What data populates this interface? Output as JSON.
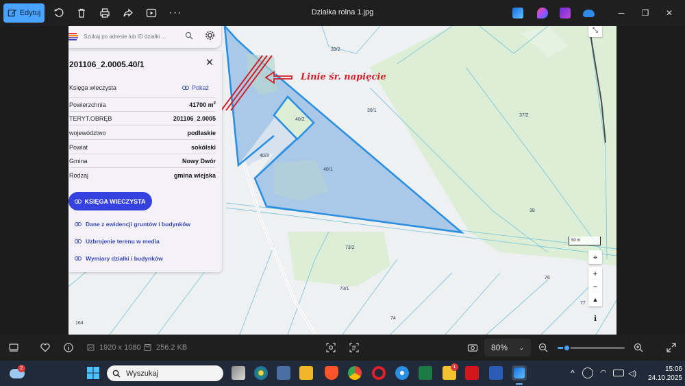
{
  "titlebar": {
    "edit_label": "Edytuj",
    "title": "Działka rolna 1.jpg"
  },
  "search": {
    "placeholder": "Szukaj po adresie lub ID działki ..."
  },
  "panel": {
    "title": "201106_2.0005.40/1",
    "rows": [
      {
        "key": "Księga wieczysta",
        "link": "Pokaż"
      },
      {
        "key": "Powierzchnia",
        "value": "41700 m",
        "sup": "2"
      },
      {
        "key": "TERYT.OBRĘB",
        "value": "201106_2.0005"
      },
      {
        "key": "województwo",
        "value": "podlaskie"
      },
      {
        "key": "Powiat",
        "value": "sokólski"
      },
      {
        "key": "Gmina",
        "value": "Nowy Dwór"
      },
      {
        "key": "Rodzaj",
        "value": "gmina wiejska"
      }
    ],
    "primary_button": "KSIĘGA WIECZYSTA",
    "links": [
      "Dane z ewidencji gruntów i budynków",
      "Uzbrojenie terenu w media",
      "Wymiary działki i budynków"
    ]
  },
  "map": {
    "annotation": "Linie śr. napięcie",
    "parcels": [
      "39/2",
      "39/1",
      "37/2",
      "40/2",
      "40/3",
      "40/1",
      "38",
      "73/2",
      "76",
      "73/1",
      "77",
      "74",
      "164"
    ],
    "scale": "50 m",
    "colors": {
      "parcel_fill": "#aac8e8",
      "parcel_stroke": "#2a8fe0",
      "green": "#dcefd6",
      "annotation": "#d21e2a"
    }
  },
  "statusbar": {
    "dimensions": "1920 x 1080",
    "size": "256.2 KB",
    "zoom": "80%"
  },
  "taskbar": {
    "search_placeholder": "Wyszukaj",
    "weather_badge": "2",
    "app_badge": "1",
    "time": "15:06",
    "date": "24.10.2025"
  }
}
